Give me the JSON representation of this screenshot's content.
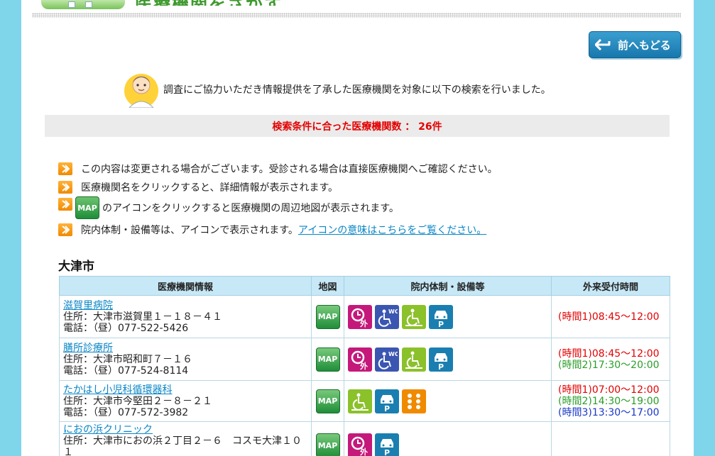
{
  "header": {
    "title_fragment": "医療機関をさがす"
  },
  "back_button": {
    "label": "前へもどる"
  },
  "intro": {
    "text": "調査にご協力いただき情報提供を了承した医療機関を対象に以下の検索を行いました。"
  },
  "result": {
    "text": "検索条件に合った医療機関数 ： 26件"
  },
  "notes": {
    "n1": "この内容は変更される場合がございます。受診される場合は直接医療機関へご確認ください。",
    "n2": "医療機関名をクリックすると、詳細情報が表示されます。",
    "n3_icon": "MAP",
    "n3": "のアイコンをクリックすると医療機関の周辺地図が表示されます。",
    "n4": "院内体制・設備等は、アイコンで表示されます。",
    "n4_link": "アイコンの意味はこちらをご覧ください。"
  },
  "city": "大津市",
  "table": {
    "headers": {
      "info": "医療機関情報",
      "map": "地図",
      "facility": "院内体制・設備等",
      "hours": "外来受付時間"
    },
    "map_label": "MAP",
    "rows": [
      {
        "name": "滋賀里病院",
        "address": "住所：大津市滋賀里１－１８－４１",
        "phone": "電話：（昼）077-522-5426",
        "facilities": [
          "time-out-icon",
          "wc-icon",
          "wheelchair-icon",
          "parking-icon"
        ],
        "hours": {
          "h1": "(時間1)08:45～12:00",
          "h2": "",
          "h3": ""
        }
      },
      {
        "name": "膳所診療所",
        "address": "住所：大津市昭和町７－１６",
        "phone": "電話：（昼）077-524-8114",
        "facilities": [
          "time-out-icon",
          "wc-icon",
          "wheelchair-icon",
          "parking-icon"
        ],
        "hours": {
          "h1": "(時間1)08:45～12:00",
          "h2": "(時間2)17:30～20:00",
          "h3": ""
        }
      },
      {
        "name": "たかはし小児科循環器科",
        "address": "住所：大津市今堅田２－８－２１",
        "phone": "電話：（昼）077-572-3982",
        "facilities": [
          "wheelchair-icon",
          "parking-icon",
          "braille-icon"
        ],
        "hours": {
          "h1": "(時間1)07:00～12:00",
          "h2": "(時間2)14:30～19:00",
          "h3": "(時間3)13:30～17:00"
        }
      },
      {
        "name": "におの浜クリニック",
        "address": "住所：大津市におの浜２丁目２－６　コスモ大津１０１",
        "phone": "",
        "facilities": [
          "time-out-icon",
          "parking-icon"
        ],
        "hours": {
          "h1": "",
          "h2": "",
          "h3": ""
        }
      }
    ]
  },
  "icon_glyphs": {
    "time": "外",
    "wc": "WC",
    "parking": "P"
  }
}
